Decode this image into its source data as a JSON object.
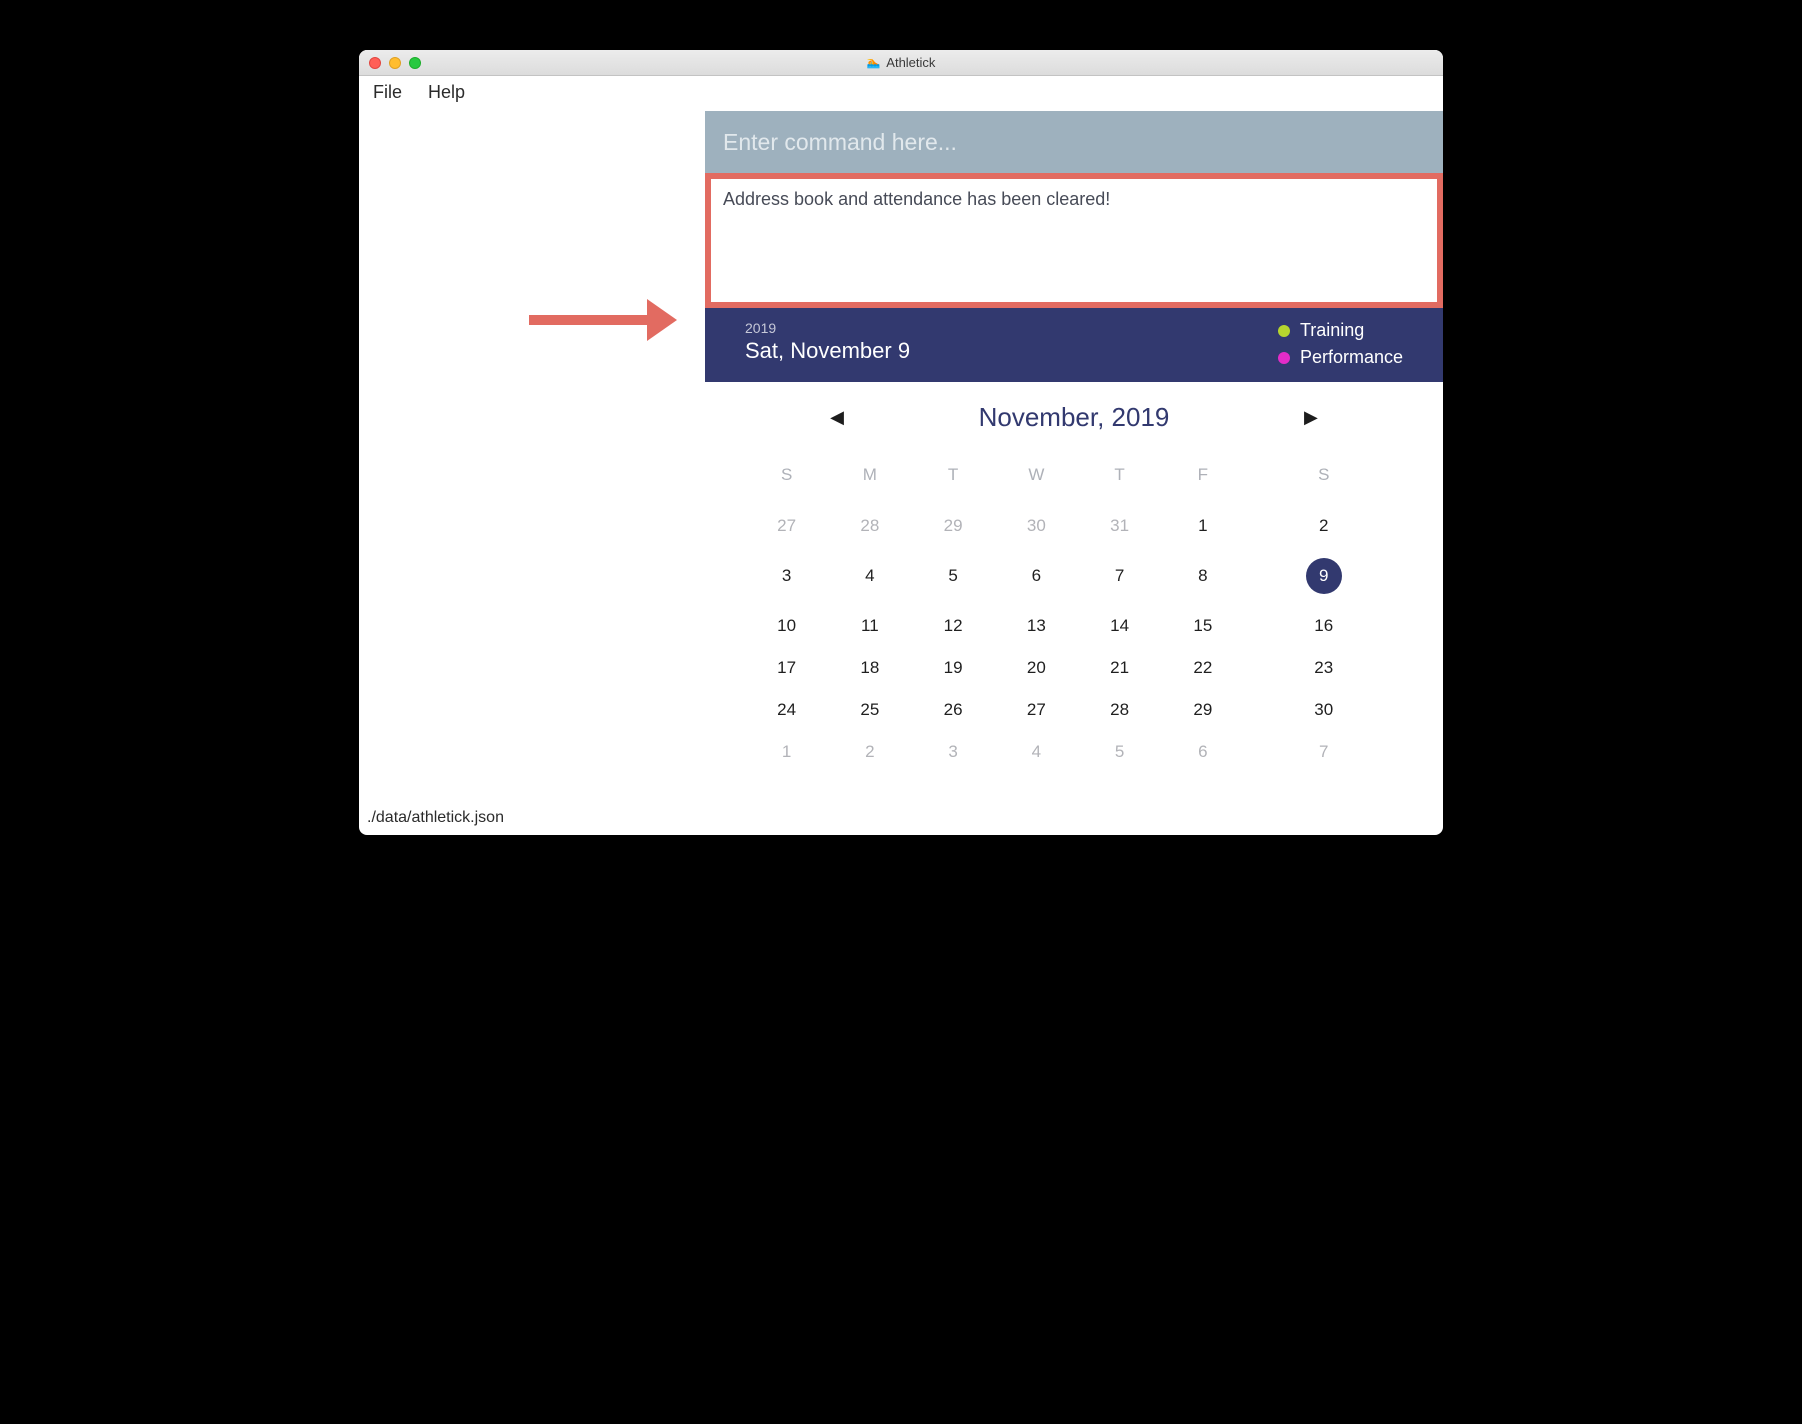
{
  "window": {
    "title": "Athletick"
  },
  "menubar": {
    "file": "File",
    "help": "Help"
  },
  "command": {
    "placeholder": "Enter command here..."
  },
  "result": {
    "message": "Address book and attendance has been cleared!"
  },
  "header": {
    "year": "2019",
    "date": "Sat, November 9",
    "legend": {
      "training": "Training",
      "performance": "Performance"
    }
  },
  "calendar": {
    "title": "November, 2019",
    "days": [
      "S",
      "M",
      "T",
      "W",
      "T",
      "F",
      "S"
    ],
    "weeks": [
      [
        {
          "d": "27",
          "o": true
        },
        {
          "d": "28",
          "o": true
        },
        {
          "d": "29",
          "o": true
        },
        {
          "d": "30",
          "o": true
        },
        {
          "d": "31",
          "o": true
        },
        {
          "d": "1"
        },
        {
          "d": "2"
        }
      ],
      [
        {
          "d": "3"
        },
        {
          "d": "4"
        },
        {
          "d": "5"
        },
        {
          "d": "6"
        },
        {
          "d": "7"
        },
        {
          "d": "8"
        },
        {
          "d": "9",
          "sel": true
        }
      ],
      [
        {
          "d": "10"
        },
        {
          "d": "11"
        },
        {
          "d": "12"
        },
        {
          "d": "13"
        },
        {
          "d": "14"
        },
        {
          "d": "15"
        },
        {
          "d": "16"
        }
      ],
      [
        {
          "d": "17"
        },
        {
          "d": "18"
        },
        {
          "d": "19"
        },
        {
          "d": "20"
        },
        {
          "d": "21"
        },
        {
          "d": "22"
        },
        {
          "d": "23"
        }
      ],
      [
        {
          "d": "24"
        },
        {
          "d": "25"
        },
        {
          "d": "26"
        },
        {
          "d": "27"
        },
        {
          "d": "28"
        },
        {
          "d": "29"
        },
        {
          "d": "30"
        }
      ],
      [
        {
          "d": "1",
          "o": true
        },
        {
          "d": "2",
          "o": true
        },
        {
          "d": "3",
          "o": true
        },
        {
          "d": "4",
          "o": true
        },
        {
          "d": "5",
          "o": true
        },
        {
          "d": "6",
          "o": true
        },
        {
          "d": "7",
          "o": true
        }
      ]
    ]
  },
  "status": {
    "path": "./data/athletick.json"
  }
}
